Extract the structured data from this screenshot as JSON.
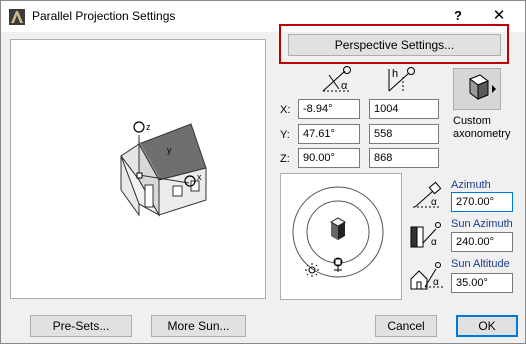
{
  "window": {
    "title": "Parallel Projection Settings",
    "help": "?",
    "close": "✕"
  },
  "buttons": {
    "perspective": "Perspective Settings...",
    "presets": "Pre-Sets...",
    "more_sun": "More Sun...",
    "cancel": "Cancel",
    "ok": "OK"
  },
  "projection": {
    "angle_symbol": "α",
    "height_symbol": "h",
    "rows": [
      {
        "label": "X:",
        "angle": "-8.94°",
        "value": "1004"
      },
      {
        "label": "Y:",
        "angle": "47.61°",
        "value": "558"
      },
      {
        "label": "Z:",
        "angle": "90.00°",
        "value": "868"
      }
    ],
    "mode_line1": "Custom",
    "mode_line2": "axonometry"
  },
  "sun": {
    "azimuth_label": "Azimuth",
    "azimuth_value": "270.00°",
    "sun_azimuth_label": "Sun Azimuth",
    "sun_azimuth_value": "240.00°",
    "sun_altitude_label": "Sun Altitude",
    "sun_altitude_value": "35.00°",
    "alpha": "α"
  },
  "preview_axes": {
    "x": "x",
    "y": "y",
    "z": "z"
  },
  "colors": {
    "highlight": "#c00000",
    "accent": "#0078d7",
    "label_blue": "#1a3e8c"
  }
}
